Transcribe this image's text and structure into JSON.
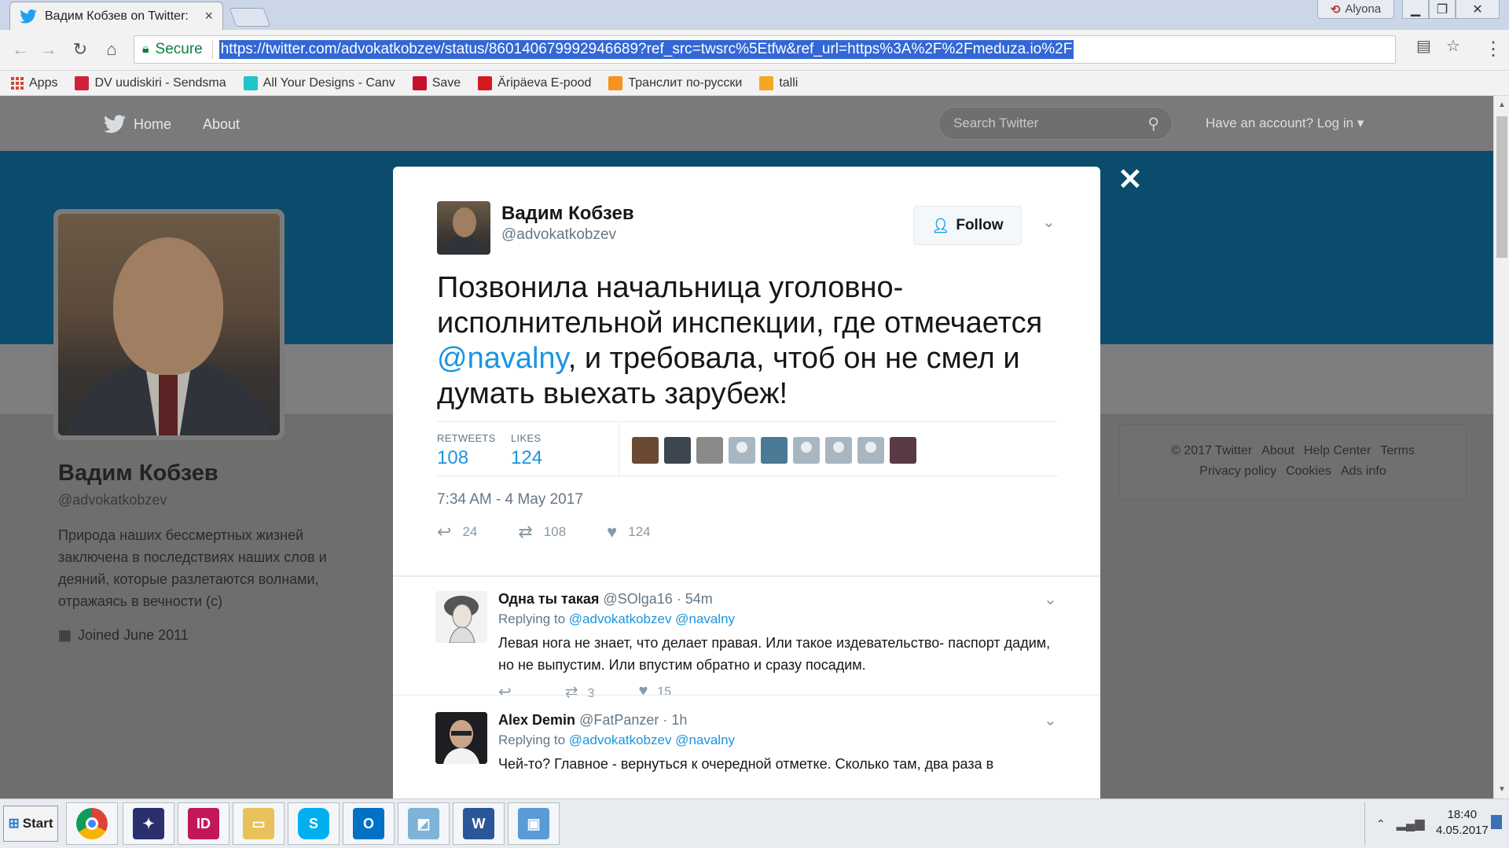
{
  "browser": {
    "tab_title": "Вадим Кобзев on Twitter:",
    "tab_close": "×",
    "profile_name": "Alyona",
    "secure_label": "Secure",
    "url": "https://twitter.com/advokatkobzev/status/860140679992946689?ref_src=twsrc%5Etfw&ref_url=https%3A%2F%2Fmeduza.io%2F",
    "bookmarks": [
      {
        "label": "Apps",
        "icon": "apps-grid-icon"
      },
      {
        "label": "DV uudiskiri - Sendsma",
        "icon": "sendsmaily-icon",
        "color": "#d0213c"
      },
      {
        "label": "All Your Designs - Canv",
        "icon": "canva-icon",
        "color": "#20c4cb"
      },
      {
        "label": "Save",
        "icon": "dv-icon",
        "color": "#c8102e"
      },
      {
        "label": "Äripäeva E-pood",
        "icon": "aripaev-icon",
        "color": "#d71920"
      },
      {
        "label": "Транслит по-русски",
        "icon": "translit-icon",
        "color": "#f7931e"
      },
      {
        "label": "talli",
        "icon": "talli-icon",
        "color": "#f5a623"
      }
    ]
  },
  "twitter_nav": {
    "home": "Home",
    "about": "About",
    "search_placeholder": "Search Twitter",
    "login": "Have an account? Log in"
  },
  "profile": {
    "name": "Вадим Кобзев",
    "handle": "@advokatkobzev",
    "bio": "Природа наших бессмертных жизней заключена в последствиях наших слов и деяний, которые разлетаются волнами, отражаясь в вечности (с)",
    "joined": "Joined June 2011"
  },
  "footer": {
    "links_row1": [
      "© 2017 Twitter",
      "About",
      "Help Center",
      "Terms"
    ],
    "links_row2": [
      "Privacy policy",
      "Cookies",
      "Ads info"
    ]
  },
  "tweet": {
    "author_name": "Вадим Кобзев",
    "author_handle": "@advokatkobzev",
    "follow_label": "Follow",
    "text_before": "Позвонила начальница уголовно-исполнительной инспекции, где отмечается ",
    "mention": "@navalny",
    "text_after": ", и требовала, чтоб он не смел и думать выехать зарубеж!",
    "retweets_label": "RETWEETS",
    "retweets_count": "108",
    "likes_label": "LIKES",
    "likes_count": "124",
    "timestamp": "7:34 AM - 4 May 2017",
    "reply_count": "24",
    "retweet_count": "108",
    "like_count": "124"
  },
  "replies": [
    {
      "name": "Одна ты такая",
      "handle": "@SOlga16",
      "time": "· 54m",
      "replying_label": "Replying to",
      "replying_to": "@advokatkobzev @navalny",
      "text": "Левая нога не знает, что делает правая. Или такое издевательство- паспорт дадим, но не выпустим. Или впустим обратно и сразу посадим.",
      "retweets": "3",
      "likes": "15"
    },
    {
      "name": "Alex Demin",
      "handle": "@FatPanzer",
      "time": "· 1h",
      "replying_label": "Replying to",
      "replying_to": "@advokatkobzev @navalny",
      "text": "Чей-то? Главное - вернуться к очередной отметке. Сколько там, два раза в"
    }
  ],
  "taskbar": {
    "start": "Start",
    "time": "18:40",
    "date": "4.05.2017"
  }
}
